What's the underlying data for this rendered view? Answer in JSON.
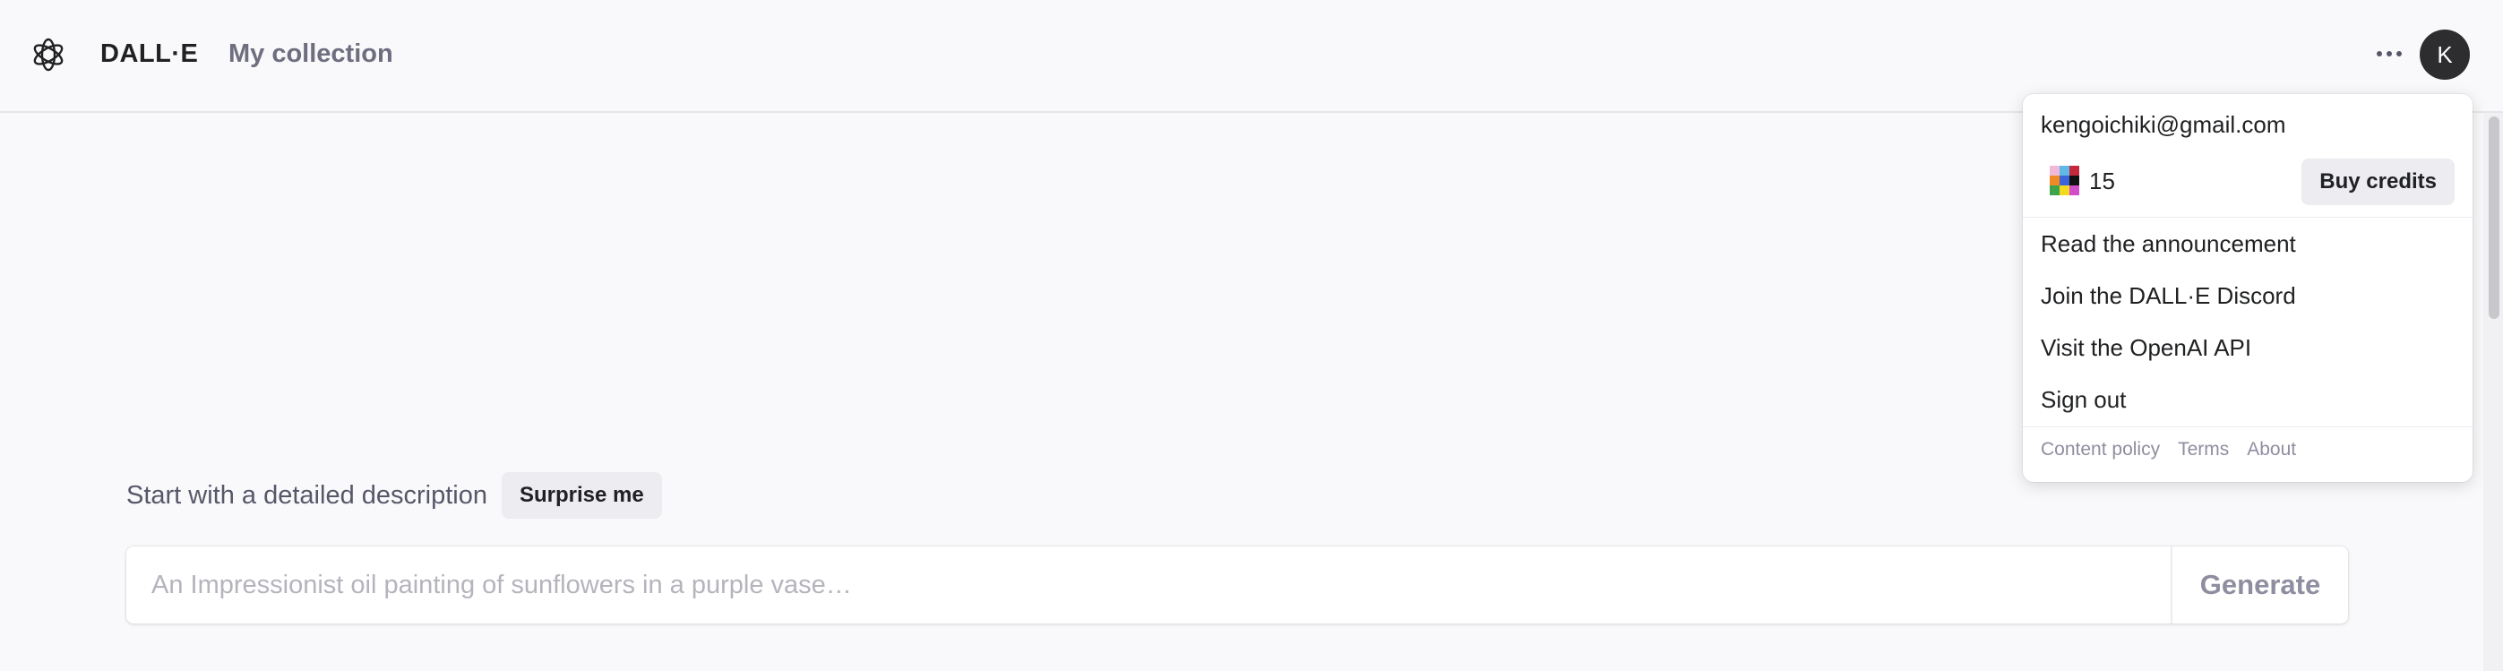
{
  "header": {
    "brand": "DALL·E",
    "nav_collection": "My collection",
    "avatar_initial": "K"
  },
  "prompt": {
    "label": "Start with a detailed description",
    "surprise_label": "Surprise me",
    "placeholder": "An Impressionist oil painting of sunflowers in a purple vase…",
    "value": "",
    "generate_label": "Generate"
  },
  "menu": {
    "email": "kengoichiki@gmail.com",
    "credits": "15",
    "buy_credits_label": "Buy credits",
    "items": [
      "Read the announcement",
      "Join the DALL·E Discord",
      "Visit the OpenAI API",
      "Sign out"
    ],
    "footer": [
      "Content policy",
      "Terms",
      "About"
    ]
  },
  "icons": {
    "logo": "openai-logo-icon",
    "more": "more-horizontal-icon",
    "credits": "credits-grid-icon"
  },
  "colors": {
    "background": "#f9f9fb",
    "text": "#202123",
    "muted": "#6e6e80",
    "button_bg": "#ececf1",
    "avatar_bg": "#2d2d2f",
    "credit_tiles": [
      "#f2b8d8",
      "#5fb8e6",
      "#c4283c",
      "#f08a24",
      "#3c64d8",
      "#111111",
      "#3da44d",
      "#f4d91e",
      "#d24ec8"
    ]
  }
}
